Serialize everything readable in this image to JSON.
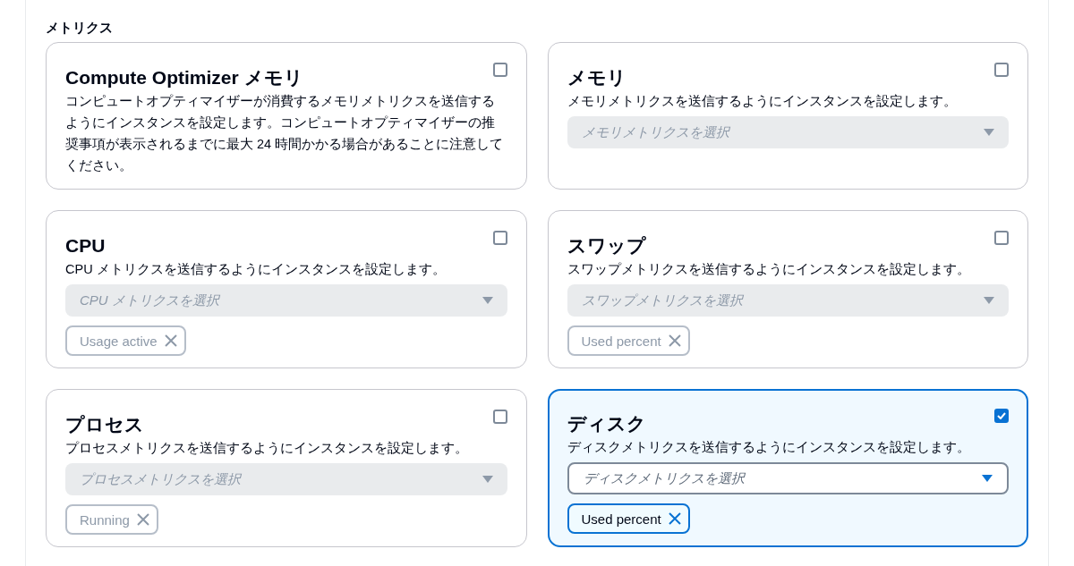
{
  "section_title": "メトリクス",
  "cards": [
    {
      "title": "Compute Optimizer メモリ",
      "checked": false,
      "description": "コンピュートオプティマイザーが消費するメモリメトリクスを送信するようにインスタンスを設定します。コンピュートオプティマイザーの推奨事項が表示されるまでに最大 24 時間かかる場合があることに注意してください。"
    },
    {
      "title": "メモリ",
      "checked": false,
      "description": "メモリメトリクスを送信するようにインスタンスを設定します。",
      "dropdown": {
        "placeholder": "メモリメトリクスを選択"
      }
    },
    {
      "title": "CPU",
      "checked": false,
      "description": "CPU メトリクスを送信するようにインスタンスを設定します。",
      "dropdown": {
        "placeholder": "CPU メトリクスを選択"
      },
      "tokens": [
        {
          "label": "Usage active"
        }
      ]
    },
    {
      "title": "スワップ",
      "checked": false,
      "description": "スワップメトリクスを送信するようにインスタンスを設定します。",
      "dropdown": {
        "placeholder": "スワップメトリクスを選択"
      },
      "tokens": [
        {
          "label": "Used percent"
        }
      ]
    },
    {
      "title": "プロセス",
      "checked": false,
      "description": "プロセスメトリクスを送信するようにインスタンスを設定します。",
      "dropdown": {
        "placeholder": "プロセスメトリクスを選択"
      },
      "tokens": [
        {
          "label": "Running"
        }
      ]
    },
    {
      "title": "ディスク",
      "checked": true,
      "description": "ディスクメトリクスを送信するようにインスタンスを設定します。",
      "dropdown": {
        "placeholder": "ディスクメトリクスを選択"
      },
      "tokens": [
        {
          "label": "Used percent"
        }
      ]
    }
  ]
}
